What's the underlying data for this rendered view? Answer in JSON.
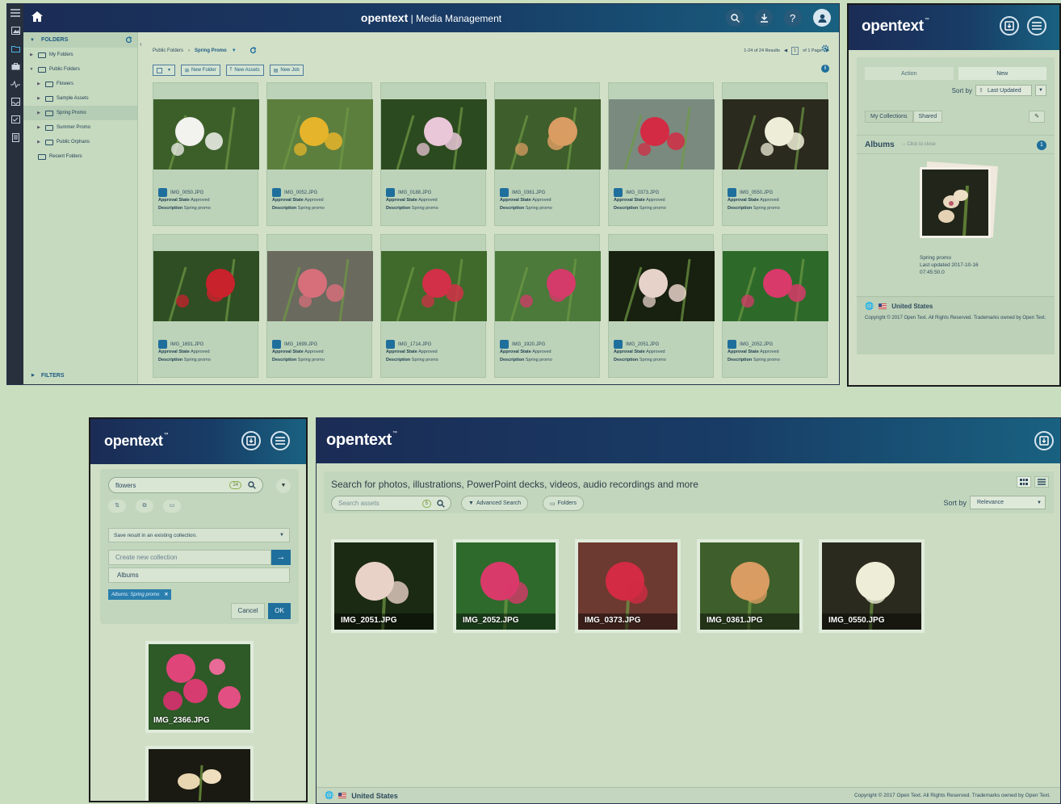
{
  "windowA": {
    "title_brand": "opentext",
    "title_rest": "| Media Management",
    "panel_heading": "FOLDERS",
    "tree": [
      {
        "label": "My Folders",
        "indent": 0,
        "open": false,
        "selected": false
      },
      {
        "label": "Public Folders",
        "indent": 0,
        "open": true,
        "selected": false
      },
      {
        "label": "Flowers",
        "indent": 1,
        "open": false,
        "selected": false
      },
      {
        "label": "Sample Assets",
        "indent": 1,
        "open": false,
        "selected": false
      },
      {
        "label": "Spring Promo",
        "indent": 1,
        "open": false,
        "selected": true
      },
      {
        "label": "Summer Promo",
        "indent": 1,
        "open": false,
        "selected": false
      },
      {
        "label": "Public Orphans",
        "indent": 1,
        "open": false,
        "selected": false
      },
      {
        "label": "Recent Folders",
        "indent": 0,
        "open": false,
        "selected": false
      }
    ],
    "filters_label": "FILTERS",
    "breadcrumb": [
      "Public Folders",
      "Spring Promo"
    ],
    "results": "1-24 of 24 Results",
    "page_current": "1",
    "page_of": "of 1 Page",
    "toolbar": {
      "new_folder": "New Folder",
      "new_assets": "New Assets",
      "new_job": "New Job"
    },
    "meta_labels": {
      "approval": "Approval State",
      "description": "Description"
    },
    "assets": [
      {
        "name": "IMG_0050.JPG",
        "approval": "Approved",
        "description": "Spring promo",
        "palette": [
          "#3c5f2a",
          "#f2f2ee"
        ]
      },
      {
        "name": "IMG_0052.JPG",
        "approval": "Approved",
        "description": "Spring promo",
        "palette": [
          "#5d7f3e",
          "#e6b42a"
        ]
      },
      {
        "name": "IMG_0188.JPG",
        "approval": "Approved",
        "description": "Spring promo",
        "palette": [
          "#2c4a1f",
          "#e9c6d8"
        ]
      },
      {
        "name": "IMG_0361.JPG",
        "approval": "Approved",
        "description": "Spring promo",
        "palette": [
          "#3e5e2b",
          "#d99c62"
        ]
      },
      {
        "name": "IMG_0373.JPG",
        "approval": "Approved",
        "description": "Spring promo",
        "palette": [
          "#7a8a7f",
          "#d22b43"
        ]
      },
      {
        "name": "IMG_0550.JPG",
        "approval": "Approved",
        "description": "Spring promo",
        "palette": [
          "#2a2a1e",
          "#eeeed8"
        ]
      },
      {
        "name": "IMG_1691.JPG",
        "approval": "Approved",
        "description": "Spring promo",
        "palette": [
          "#2f4e23",
          "#c8222c"
        ]
      },
      {
        "name": "IMG_1699.JPG",
        "approval": "Approved",
        "description": "Spring promo",
        "palette": [
          "#6a6a5e",
          "#d66f7a"
        ]
      },
      {
        "name": "IMG_1714.JPG",
        "approval": "Approved",
        "description": "Spring promo",
        "palette": [
          "#3f6a2b",
          "#d23048"
        ]
      },
      {
        "name": "IMG_1920.JPG",
        "approval": "Approved",
        "description": "Spring promo",
        "palette": [
          "#4b7a3a",
          "#d43b6a"
        ]
      },
      {
        "name": "IMG_2051.JPG",
        "approval": "Approved",
        "description": "Spring promo",
        "palette": [
          "#18200f",
          "#e6d2c8"
        ]
      },
      {
        "name": "IMG_2052.JPG",
        "approval": "Approved",
        "description": "Spring promo",
        "palette": [
          "#2d6a2a",
          "#d83a6a"
        ]
      }
    ]
  },
  "windowB": {
    "logo": "opentext",
    "actions": [
      "Action",
      "New"
    ],
    "sort_label": "Sort by",
    "sort_value": "Last Updated",
    "collection_tabs": [
      "My Collections",
      "Shared"
    ],
    "albums_label": "Albums",
    "click_to_close": "-- Click to close",
    "albums_count": "1",
    "album_name": "Spring promo",
    "album_updated": "Last updated 2017-10-16",
    "album_time": "07:45:50.0",
    "country": "United States",
    "copyright": "Copyright © 2017 Open Text. All Rights Reserved. Trademarks owned by Open Text."
  },
  "windowC": {
    "logo": "opentext",
    "search_value": "flowers",
    "search_count": "24",
    "save_option": "Save result in an existing collection.",
    "create_placeholder": "Create new collection",
    "albums_value": "Albums",
    "tag": "Albums: Spring promo",
    "cancel": "Cancel",
    "ok": "OK",
    "thumbs": [
      {
        "name": "IMG_2366.JPG",
        "palette": [
          "#2e5a28",
          "#e0457a"
        ]
      },
      {
        "name": "",
        "palette": [
          "#1a1a12",
          "#e8d6b0"
        ]
      }
    ]
  },
  "windowD": {
    "logo": "opentext",
    "hint": "Search for photos, illustrations, PowerPoint decks, videos, audio recordings and more",
    "search_placeholder": "Search assets",
    "search_count": "5",
    "advanced_search": "Advanced Search",
    "folders": "Folders",
    "sort_label": "Sort by",
    "sort_value": "Relevance",
    "results": [
      {
        "name": "IMG_2051.JPG",
        "palette": [
          "#1b2a12",
          "#e8d2c8"
        ]
      },
      {
        "name": "IMG_2052.JPG",
        "palette": [
          "#2e6a2c",
          "#d83a6a"
        ]
      },
      {
        "name": "IMG_0373.JPG",
        "palette": [
          "#6c3a30",
          "#d22b43"
        ]
      },
      {
        "name": "IMG_0361.JPG",
        "palette": [
          "#3e5e2b",
          "#d99c62"
        ]
      },
      {
        "name": "IMG_0550.JPG",
        "palette": [
          "#2a2a1e",
          "#eeeed8"
        ]
      }
    ],
    "country": "United States",
    "copyright": "Copyright © 2017 Open Text. All Rights Reserved. Trademarks owned by Open Text."
  }
}
